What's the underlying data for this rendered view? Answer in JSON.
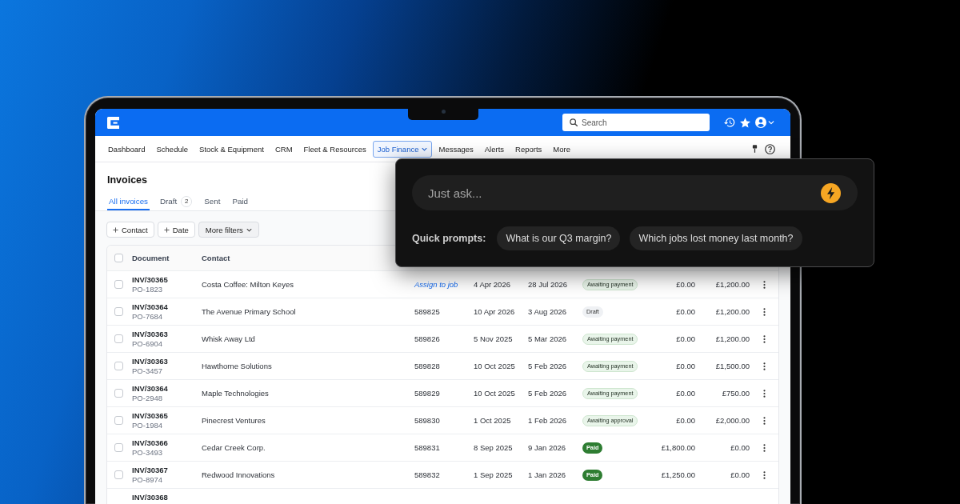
{
  "topbar": {
    "search": {
      "placeholder": "Search"
    }
  },
  "nav": {
    "items": [
      {
        "label": "Dashboard",
        "selected": false,
        "menu": false
      },
      {
        "label": "Schedule",
        "selected": false,
        "menu": false
      },
      {
        "label": "Stock & Equipment",
        "selected": false,
        "menu": false
      },
      {
        "label": "CRM",
        "selected": false,
        "menu": false
      },
      {
        "label": "Fleet & Resources",
        "selected": false,
        "menu": false
      },
      {
        "label": "Job Finance",
        "selected": true,
        "menu": true
      },
      {
        "label": "Messages",
        "selected": false,
        "menu": false
      },
      {
        "label": "Alerts",
        "selected": false,
        "menu": false
      },
      {
        "label": "Reports",
        "selected": false,
        "menu": false
      },
      {
        "label": "More",
        "selected": false,
        "menu": false
      }
    ]
  },
  "page": {
    "title": "Invoices",
    "tabs": [
      {
        "label": "All invoices",
        "selected": true
      },
      {
        "label": "Draft",
        "selected": false,
        "count": "2"
      },
      {
        "label": "Sent",
        "selected": false
      },
      {
        "label": "Paid",
        "selected": false
      }
    ],
    "filters": [
      {
        "label": "Contact",
        "kind": "add"
      },
      {
        "label": "Date",
        "kind": "add"
      },
      {
        "label": "More filters",
        "kind": "menu"
      }
    ]
  },
  "table": {
    "select_all": {
      "checked": false
    },
    "columns": [
      "Document",
      "Contact"
    ],
    "rows": [
      {
        "checked": false,
        "document": "INV/30365",
        "reference": "PO-1823",
        "contact": "Costa Coffee: Milton Keyes",
        "job": {
          "label": "Assign to job",
          "kind": "link"
        },
        "issued": "4 Apr 2026",
        "due": "28 Jul 2026",
        "status": {
          "label": "Awaiting payment",
          "kind": "awaiting"
        },
        "paid": "£0.00",
        "amount_due": "£1,200.00"
      },
      {
        "checked": false,
        "document": "INV/30364",
        "reference": "PO-7684",
        "contact": "The Avenue Primary School",
        "job": {
          "label": "589825",
          "kind": "number"
        },
        "issued": "10 Apr 2026",
        "due": "3 Aug 2026",
        "status": {
          "label": "Draft",
          "kind": "draft"
        },
        "paid": "£0.00",
        "amount_due": "£1,200.00"
      },
      {
        "checked": false,
        "document": "INV/30363",
        "reference": "PO-6904",
        "contact": "Whisk Away Ltd",
        "job": {
          "label": "589826",
          "kind": "number"
        },
        "issued": "5 Nov 2025",
        "due": "5 Mar 2026",
        "status": {
          "label": "Awaiting payment",
          "kind": "awaiting"
        },
        "paid": "£0.00",
        "amount_due": "£1,200.00"
      },
      {
        "checked": false,
        "document": "INV/30363",
        "reference": "PO-3457",
        "contact": "Hawthorne Solutions",
        "job": {
          "label": "589828",
          "kind": "number"
        },
        "issued": "10 Oct 2025",
        "due": "5 Feb 2026",
        "status": {
          "label": "Awaiting payment",
          "kind": "awaiting"
        },
        "paid": "£0.00",
        "amount_due": "£1,500.00"
      },
      {
        "checked": false,
        "document": "INV/30364",
        "reference": "PO-2948",
        "contact": "Maple Technologies",
        "job": {
          "label": "589829",
          "kind": "number"
        },
        "issued": "10 Oct 2025",
        "due": "5 Feb 2026",
        "status": {
          "label": "Awaiting payment",
          "kind": "awaiting"
        },
        "paid": "£0.00",
        "amount_due": "£750.00"
      },
      {
        "checked": false,
        "document": "INV/30365",
        "reference": "PO-1984",
        "contact": "Pinecrest Ventures",
        "job": {
          "label": "589830",
          "kind": "number"
        },
        "issued": "1 Oct 2025",
        "due": "1 Feb 2026",
        "status": {
          "label": "Awaiting approval",
          "kind": "awaiting"
        },
        "paid": "£0.00",
        "amount_due": "£2,000.00"
      },
      {
        "checked": false,
        "document": "INV/30366",
        "reference": "PO-3493",
        "contact": "Cedar Creek Corp.",
        "job": {
          "label": "589831",
          "kind": "number"
        },
        "issued": "8 Sep 2025",
        "due": "9 Jan 2026",
        "status": {
          "label": "Paid",
          "kind": "paid"
        },
        "paid": "£1,800.00",
        "amount_due": "£0.00"
      },
      {
        "checked": false,
        "document": "INV/30367",
        "reference": "PO-8974",
        "contact": "Redwood Innovations",
        "job": {
          "label": "589832",
          "kind": "number"
        },
        "issued": "1 Sep 2025",
        "due": "1 Jan 2026",
        "status": {
          "label": "Paid",
          "kind": "paid"
        },
        "paid": "£1,250.00",
        "amount_due": "£0.00"
      },
      {
        "document": "INV/30368"
      }
    ]
  },
  "assistant": {
    "placeholder": "Just ask...",
    "prompts_label": "Quick prompts:",
    "prompts": [
      "What is our Q3 margin?",
      "Which jobs lost money last month?"
    ]
  }
}
